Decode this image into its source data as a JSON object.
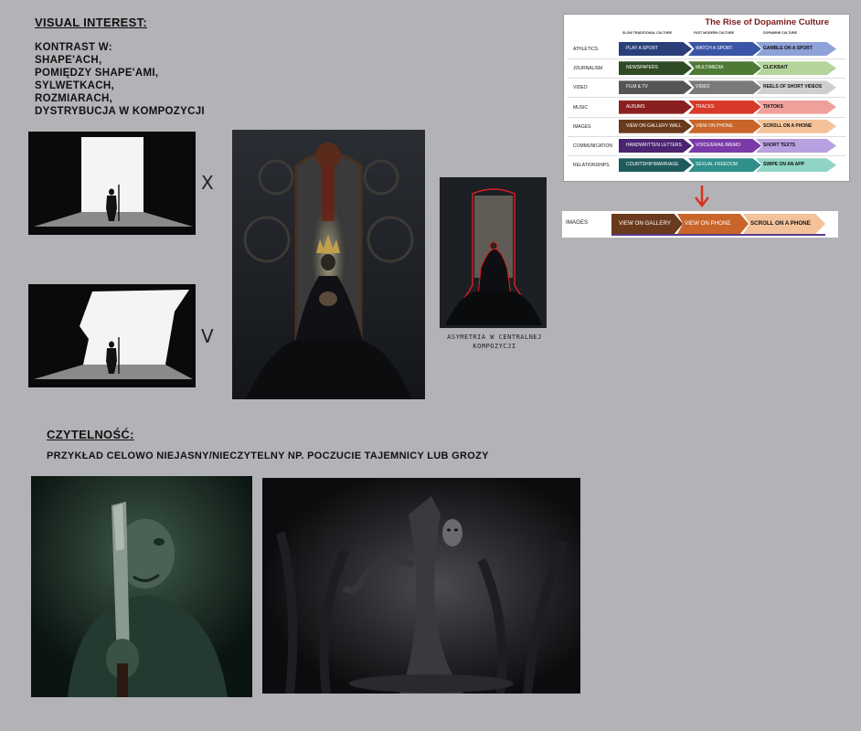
{
  "visual_interest": {
    "heading": "VISUAL INTEREST:",
    "lines": [
      "KONTRAST W:",
      "SHAPE'ACH,",
      "POMIĘDZY SHAPE'AMI,",
      "SYLWETKACH,",
      "ROZMIARACH,",
      "DYSTRYBUCJA W KOMPOZYCJI"
    ],
    "mark_wrong": "X",
    "mark_right": "V",
    "asymmetry_note": [
      "ASYMETRIA W CENTRALNEJ",
      "KOMPOZYCJI"
    ]
  },
  "infographic": {
    "title": "The Rise of Dopamine Culture",
    "columns": [
      "SLOW TRADITIONAL CULTURE",
      "FAST MODERN CULTURE",
      "DOPAMINE CULTURE"
    ],
    "rows": [
      {
        "label": "ATHLETICS",
        "cells": [
          "PLAY A SPORT",
          "WATCH A SPORT",
          "GAMBLE ON A SPORT"
        ],
        "colors": [
          "#2a3f7a",
          "#3b55a6",
          "#8ea2d8"
        ]
      },
      {
        "label": "JOURNALISM",
        "cells": [
          "NEWSPAPERS",
          "MULTIMEDIA",
          "CLICKBAIT"
        ],
        "colors": [
          "#2f4a24",
          "#4f7a36",
          "#b4d49a"
        ]
      },
      {
        "label": "VIDEO",
        "cells": [
          "FILM & TV",
          "VIDEO",
          "REELS OF SHORT VIDEOS"
        ],
        "colors": [
          "#555555",
          "#7a7a7a",
          "#cfcfcf"
        ]
      },
      {
        "label": "MUSIC",
        "cells": [
          "ALBUMS",
          "TRACKS",
          "TIKTOKS"
        ],
        "colors": [
          "#8a1f1f",
          "#d73a2a",
          "#f0a09a"
        ]
      },
      {
        "label": "IMAGES",
        "cells": [
          "VIEW ON GALLERY WALL",
          "VIEW ON PHONE",
          "SCROLL ON A PHONE"
        ],
        "colors": [
          "#6a3a1c",
          "#c9652a",
          "#f3c29a"
        ]
      },
      {
        "label": "COMMUNICATION",
        "cells": [
          "HANDWRITTEN LETTERS",
          "VOICE/EMAIL/MEMO",
          "SHORT TEXTS"
        ],
        "colors": [
          "#4a2470",
          "#7a3aa8",
          "#b9a0e0"
        ]
      },
      {
        "label": "RELATIONSHIPS",
        "cells": [
          "COURTSHIP/MARRIAGE",
          "SEXUAL FREEDOM",
          "SWIPE ON AN APP"
        ],
        "colors": [
          "#1f5a5c",
          "#2f8f8a",
          "#8fd4c4"
        ]
      }
    ],
    "arrow_color": "#d8321e"
  },
  "zoom_row": {
    "label": "IMAGES",
    "cells": [
      "VIEW ON GALLERY WALL",
      "VIEW ON PHONE",
      "SCROLL ON A PHONE"
    ],
    "colors": [
      "#6a3a1c",
      "#c9652a",
      "#f3c29a"
    ]
  },
  "readability": {
    "heading": "CZYTELNOŚĆ:",
    "subtitle": "PRZYKŁAD CELOWO NIEJASNY/NIECZYTELNY NP. POCZUCIE TAJEMNICY LUB GROZY"
  }
}
